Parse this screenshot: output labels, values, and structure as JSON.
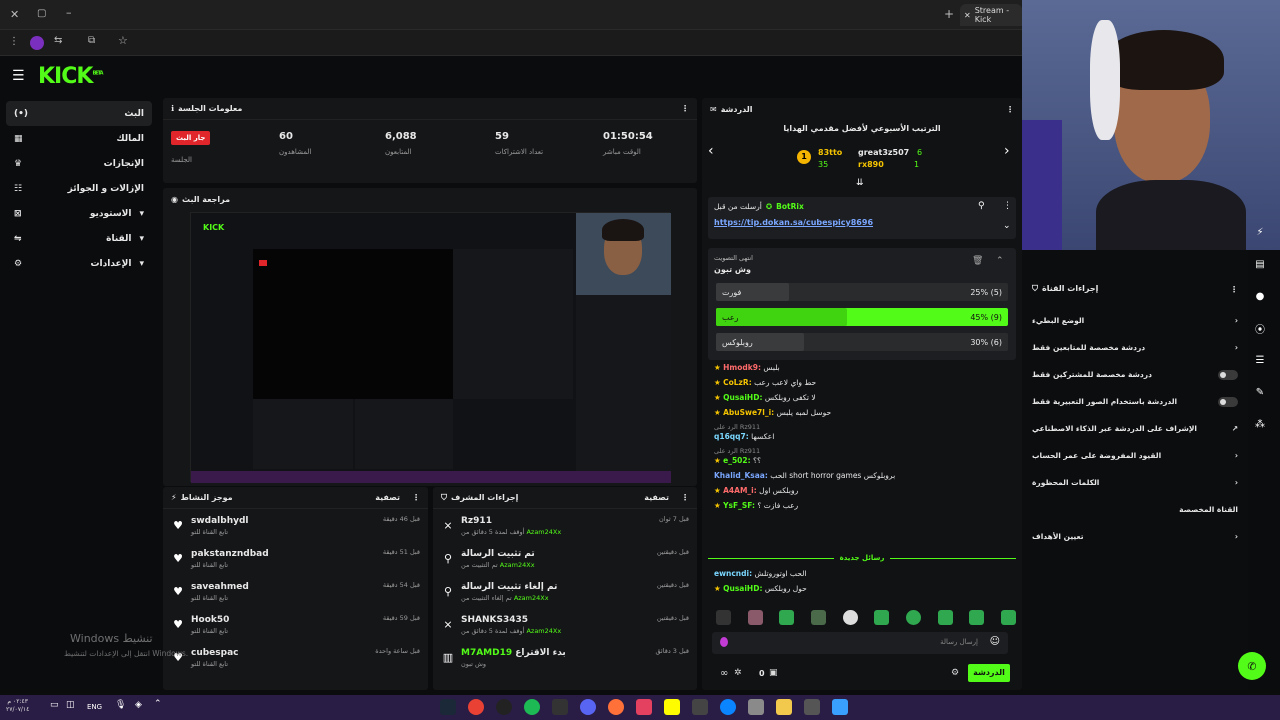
{
  "browser": {
    "tab_title": "Stream - Kick"
  },
  "app": {
    "logo": "KICK",
    "logo_badge": "BETA"
  },
  "sidebar": {
    "items": [
      {
        "label": "البث",
        "icon": "broadcast-icon",
        "active": true
      },
      {
        "label": "المالك",
        "icon": "grid-icon"
      },
      {
        "label": "الإنجازات",
        "icon": "trophy-icon"
      },
      {
        "label": "الإزالات و الجوائز",
        "icon": "gift-icon"
      },
      {
        "label": "الاستوديو",
        "icon": "studio-icon",
        "expandable": true
      },
      {
        "label": "القناة",
        "icon": "channel-icon",
        "expandable": true
      },
      {
        "label": "الإعدادات",
        "icon": "gear-icon",
        "expandable": true
      }
    ]
  },
  "session": {
    "title": "معلومات الجلسة",
    "live_badge": "جار البث",
    "live_sub": "الجلسة",
    "stats": [
      {
        "value": "01:50:54",
        "label": "الوقت مباشر"
      },
      {
        "value": "59",
        "label": "تعداد الاشتراكات"
      },
      {
        "value": "6,088",
        "label": "المتابعون"
      },
      {
        "value": "60",
        "label": "المشاهدون"
      }
    ]
  },
  "preview": {
    "title": "مراجعة البث"
  },
  "activity": {
    "title": "موجز النشاط",
    "filter": "تصفية",
    "rows": [
      {
        "name": "swdalbhydl",
        "sub": "تابع القناة للتو",
        "time": "قبل 46 دقيقة"
      },
      {
        "name": "pakstanzndbad",
        "sub": "تابع القناة للتو",
        "time": "قبل 51 دقيقة"
      },
      {
        "name": "saveahmed",
        "sub": "تابع القناة للتو",
        "time": "قبل 54 دقيقة"
      },
      {
        "name": "Hook50",
        "sub": "تابع القناة للتو",
        "time": "قبل 59 دقيقة"
      },
      {
        "name": "cubespac",
        "sub": "تابع القناة للتو",
        "time": "قبل ساعة واحدة"
      }
    ]
  },
  "mod_actions": {
    "title": "إجراءات المشرف",
    "filter": "تصفية",
    "rows": [
      {
        "name": "Rz911",
        "sub": "أوقف لمدة 5 دقائق من",
        "by": "Azam24Xx",
        "time": "قبل 7 ثوان",
        "icon": "ban-icon"
      },
      {
        "name": "تم تثبيت الرسالة",
        "sub": "تم التثبيت من",
        "by": "Azam24Xx",
        "time": "قبل دقيقتين",
        "icon": "pin-icon"
      },
      {
        "name": "تم إلغاء تثبيت الرسالة",
        "sub": "تم إلغاء التثبيت من",
        "by": "Azam24Xx",
        "time": "قبل دقيقتين",
        "icon": "pin-icon"
      },
      {
        "name": "SHANKS3435",
        "sub": "أوقف لمدة 5 دقائق من",
        "by": "Azam24Xx",
        "time": "قبل دقيقتين",
        "icon": "ban-icon"
      },
      {
        "name": "M7AMD19",
        "sub": "وش تبون",
        "by": "بدء الاقتراع",
        "time": "قبل 3 دقائق",
        "icon": "poll-icon"
      }
    ]
  },
  "chat": {
    "title": "الدردشة",
    "leaderboard_title": "الترتيب الأسبوعي لأفضل مقدمي الهدايا",
    "leaders": [
      {
        "name": "83tto",
        "count": "35",
        "rank": "1"
      },
      {
        "name": "great3z507",
        "count": "6"
      },
      {
        "name": "rx890",
        "count": "1"
      }
    ],
    "pinned_by": "أرسلت من قبل",
    "pinned_user": "BotRix",
    "pinned_link": "https://tip.dokan.sa/cubespicy8696",
    "poll": {
      "status": "انتهى التصويت",
      "question": "وش تبون",
      "options": [
        {
          "label": "فورت",
          "result": "25% (5)",
          "pct": 25,
          "selected": false
        },
        {
          "label": "رعب",
          "result": "45% (9)",
          "pct": 45,
          "selected": true
        },
        {
          "label": "روبلوكس",
          "result": "30% (6)",
          "pct": 30,
          "selected": false
        }
      ]
    },
    "messages": [
      {
        "user": "Hmodk9:",
        "text": "بلبس",
        "color": "#ff6b6b"
      },
      {
        "user": "CoLzR:",
        "text": "حط واي لاعب رعب",
        "color": "#f5c400"
      },
      {
        "user": "QusaiHD:",
        "text": "لا تكفى روبلكس",
        "color": "#53fc18"
      },
      {
        "user": "AbuSwe7l_i:",
        "text": "حوسل لمبه يلبس",
        "color": "#f5c400"
      },
      {
        "user": "q16qq7:",
        "text": "اعكسها",
        "color": "#7ad7ff",
        "reply": "الرد على Rz911"
      },
      {
        "user": "e_502:",
        "text": "؟؟",
        "color": "#53fc18",
        "reply": "الرد على Rz911"
      },
      {
        "user": "Khalid_Ksaa:",
        "text": "الحب short horror games بروبلوكس",
        "color": "#7aa7ff"
      },
      {
        "user": "A4AM_i:",
        "text": "روبلكس اول",
        "color": "#ff6b6b"
      },
      {
        "user": "YsF_SF:",
        "text": "رعب فازت ؟",
        "color": "#53fc18"
      }
    ],
    "new_messages": "رسائل جديدة",
    "after_messages": [
      {
        "user": "ewncndi:",
        "text": "الحب اوتوروتلش",
        "color": "#7ad7ff"
      },
      {
        "user": "QusaiHD:",
        "text": "حول روبلكس",
        "color": "#53fc18"
      }
    ],
    "input_placeholder": "إرسال رسالة",
    "count": "0",
    "send_label": "الدردشة"
  },
  "channel_actions": {
    "title": "إجراءات القناة",
    "rows": [
      {
        "label": "الوضع البطيء",
        "type": "arrow"
      },
      {
        "label": "دردشة مخصصة للمتابعين فقط",
        "type": "arrow"
      },
      {
        "label": "دردشة مخصصة للمشتركين فقط",
        "type": "toggle"
      },
      {
        "label": "الدردشة باستخدام الصور التعبيرية فقط",
        "type": "toggle"
      },
      {
        "label": "الإشراف على الدردشة عبر الذكاء الاصطناعي",
        "type": "external"
      },
      {
        "label": "القيود المفروضة على عمر الحساب",
        "type": "arrow"
      },
      {
        "label": "الكلمات المحظورة",
        "type": "arrow"
      },
      {
        "label": "القناة المخصصة",
        "type": "none"
      },
      {
        "label": "تعيين الأهداف",
        "type": "arrow"
      }
    ]
  },
  "watermark": {
    "line1": "Windows تنشيط",
    "line2": "انتقل إلى الإعدادات لتنشيط Windows."
  },
  "taskbar": {
    "lang": "ENG",
    "time": "٠٢:٤٣ م",
    "date": "٢٧/٠٧/١٤"
  }
}
